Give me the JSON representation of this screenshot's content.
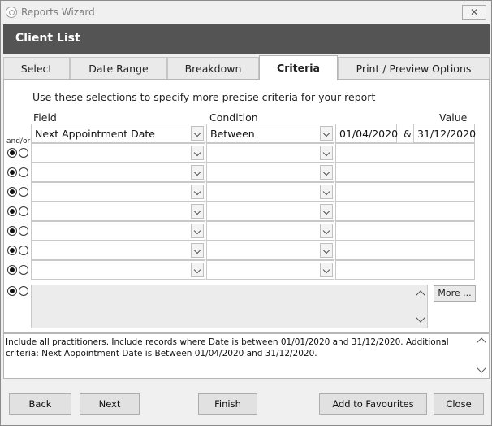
{
  "window": {
    "title": "Reports Wizard",
    "close_glyph": "✕"
  },
  "header": {
    "title": "Client List"
  },
  "tabs": [
    {
      "label": "Select",
      "active": false
    },
    {
      "label": "Date Range",
      "active": false
    },
    {
      "label": "Breakdown",
      "active": false
    },
    {
      "label": "Criteria",
      "active": true
    },
    {
      "label": "Print / Preview Options",
      "active": false
    }
  ],
  "criteria": {
    "intro": "Use these selections to specify more precise criteria for your report",
    "columns": {
      "field": "Field",
      "condition": "Condition",
      "value": "Value"
    },
    "andor_label": "and/or",
    "amp": "&",
    "rows": [
      {
        "field": "Next Appointment Date",
        "condition": "Between",
        "value1": "01/04/2020",
        "value2": "31/12/2020"
      },
      {
        "field": "",
        "condition": "",
        "value1": "",
        "value2": ""
      },
      {
        "field": "",
        "condition": "",
        "value1": "",
        "value2": ""
      },
      {
        "field": "",
        "condition": "",
        "value1": "",
        "value2": ""
      },
      {
        "field": "",
        "condition": "",
        "value1": "",
        "value2": ""
      },
      {
        "field": "",
        "condition": "",
        "value1": "",
        "value2": ""
      },
      {
        "field": "",
        "condition": "",
        "value1": "",
        "value2": ""
      },
      {
        "field": "",
        "condition": "",
        "value1": "",
        "value2": ""
      }
    ],
    "more_button": "More ..."
  },
  "summary": {
    "text": "Include all practitioners. Include records where Date is between 01/01/2020 and 31/12/2020. Additional criteria: Next Appointment Date is Between 01/04/2020 and 31/12/2020."
  },
  "buttons": {
    "back": "Back",
    "next": "Next",
    "finish": "Finish",
    "add_favourites": "Add to Favourites",
    "close": "Close"
  },
  "colors": {
    "header_band": "#545454",
    "panel_bg": "#ffffff",
    "window_bg": "#f0f0f0"
  }
}
